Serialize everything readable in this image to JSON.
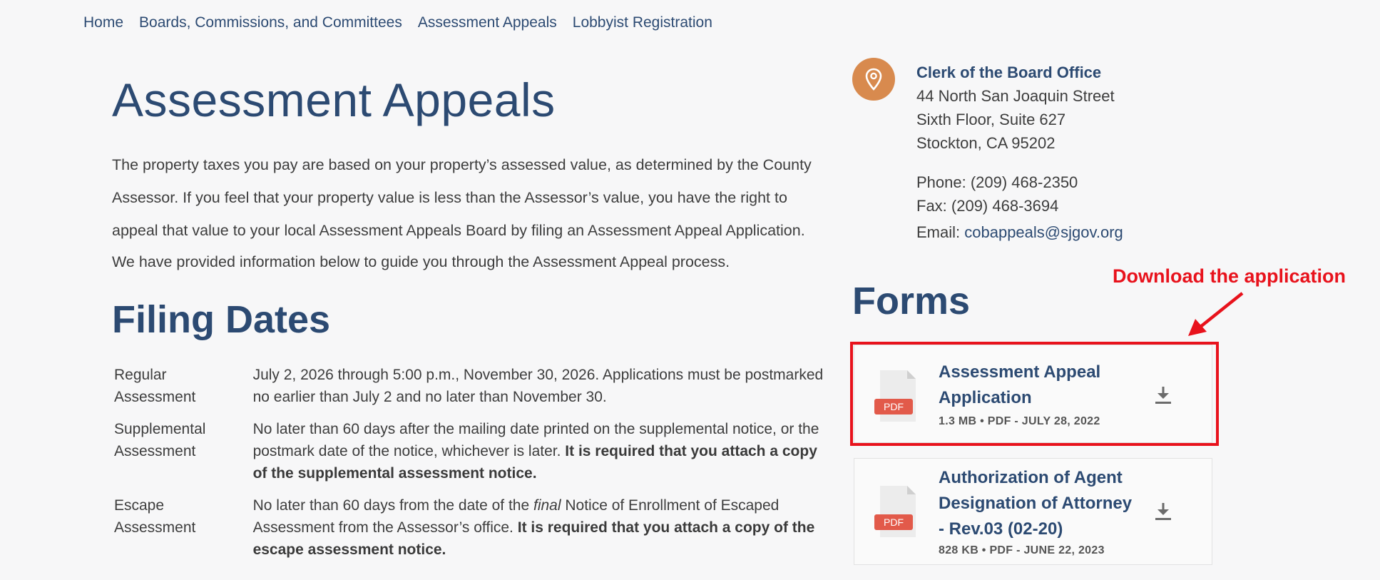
{
  "breadcrumb": {
    "items": [
      "Home",
      "Boards, Commissions, and Committees",
      "Assessment Appeals",
      "Lobbyist Registration"
    ]
  },
  "main": {
    "title": "Assessment Appeals",
    "intro": "The property taxes you pay are based on your property’s assessed value, as determined by the County Assessor. If you feel that your property value is less than the Assessor’s value, you have the right to appeal that value to your local Assessment Appeals Board by filing an Assessment Appeal Application.",
    "intro2": "We have provided information below to guide you through the Assessment Appeal process.",
    "filing_title": "Filing Dates",
    "filing_rows": [
      {
        "label_line1": "Regular",
        "label_line2": "Assessment",
        "text": "July 2, 2026 through 5:00 p.m., November 30, 2026. Applications must be postmarked no earlier than July 2 and no later than November 30.",
        "bold": ""
      },
      {
        "label_line1": "Supplemental",
        "label_line2": "Assessment",
        "text": "No later than 60 days after the mailing date printed on the supplemental notice, or the postmark date of the notice, whichever is later. ",
        "bold": "It is required that you attach a copy of the supplemental assessment notice."
      },
      {
        "label_line1": "Escape",
        "label_line2": "Assessment",
        "text_before": "No later than 60 days from the date of the ",
        "italic": "final",
        "text_after": " Notice of Enrollment of Escaped Assessment from the Assessor’s office.  ",
        "bold": "It is required that you attach a copy of the escape assessment notice."
      }
    ]
  },
  "contact": {
    "office": "Clerk of the Board Office",
    "address_line1": "44 North San Joaquin Street",
    "address_line2": "Sixth Floor, Suite 627",
    "address_line3": "Stockton, CA 95202",
    "phone": "Phone: (209) 468-2350",
    "fax": "Fax: (209) 468-3694",
    "email_label": "Email: ",
    "email": "cobappeals@sjgov.org"
  },
  "forms": {
    "title": "Forms",
    "items": [
      {
        "name_line1": "Assessment Appeal",
        "name_line2": "Application",
        "meta": "1.3 MB • PDF - JULY 28, 2022",
        "badge": "PDF"
      },
      {
        "name_line1": "Authorization of Agent",
        "name_line2": "Designation of Attorney",
        "name_line3": "- Rev.03 (02-20)",
        "meta": "828 KB • PDF - JUNE 22, 2023",
        "badge": "PDF"
      }
    ]
  },
  "annotation": {
    "callout": "Download the application",
    "color": "#e8121c"
  },
  "colors": {
    "brand": "#2c4a72",
    "pin": "#d88a4e",
    "pdf_badge": "#e25a4a"
  }
}
